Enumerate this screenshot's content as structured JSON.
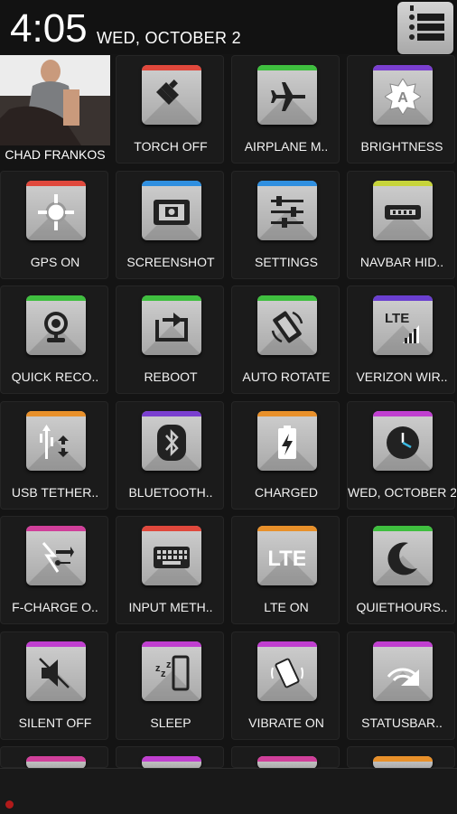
{
  "status": {
    "time": "4:05",
    "date": "WED, OCTOBER 2"
  },
  "profile": {
    "name": "CHAD FRANKOS"
  },
  "tiles": [
    {
      "label": "TORCH OFF",
      "icon": "torch-icon",
      "accent": "#e0483c"
    },
    {
      "label": "AIRPLANE M..",
      "icon": "airplane-icon",
      "accent": "#3fbf3f"
    },
    {
      "label": "BRIGHTNESS",
      "icon": "brightness-icon",
      "accent": "#7a3fd0"
    },
    {
      "label": "GPS ON",
      "icon": "gps-icon",
      "accent": "#e0483c"
    },
    {
      "label": "SCREENSHOT",
      "icon": "screenshot-icon",
      "accent": "#2f8fe0"
    },
    {
      "label": "SETTINGS",
      "icon": "settings-icon",
      "accent": "#2f8fe0"
    },
    {
      "label": "NAVBAR HID..",
      "icon": "navbar-icon",
      "accent": "#c7d43a"
    },
    {
      "label": "QUICK RECO..",
      "icon": "quick-record-icon",
      "accent": "#3fbf3f"
    },
    {
      "label": "REBOOT",
      "icon": "reboot-icon",
      "accent": "#3fbf3f"
    },
    {
      "label": "AUTO ROTATE",
      "icon": "auto-rotate-icon",
      "accent": "#3fbf3f"
    },
    {
      "label": "VERIZON WIR..",
      "icon": "lte-signal-icon",
      "accent": "#6a3fd0"
    },
    {
      "label": "USB TETHER..",
      "icon": "usb-tether-icon",
      "accent": "#e8902a"
    },
    {
      "label": "BLUETOOTH..",
      "icon": "bluetooth-icon",
      "accent": "#7a3fd0"
    },
    {
      "label": "CHARGED",
      "icon": "battery-charged-icon",
      "accent": "#e8902a"
    },
    {
      "label": "WED, OCTOBER 2",
      "icon": "clock-icon",
      "accent": "#c03fd0"
    },
    {
      "label": "F-CHARGE O..",
      "icon": "fast-charge-icon",
      "accent": "#d03f9a"
    },
    {
      "label": "INPUT METH..",
      "icon": "keyboard-icon",
      "accent": "#e0483c"
    },
    {
      "label": "LTE ON",
      "icon": "lte-icon",
      "accent": "#e8902a"
    },
    {
      "label": "QUIETHOURS..",
      "icon": "moon-icon",
      "accent": "#3fbf3f"
    },
    {
      "label": "SILENT OFF",
      "icon": "silent-off-icon",
      "accent": "#c03fd0"
    },
    {
      "label": "SLEEP",
      "icon": "sleep-icon",
      "accent": "#c03fd0"
    },
    {
      "label": "VIBRATE ON",
      "icon": "vibrate-icon",
      "accent": "#c03fd0"
    },
    {
      "label": "STATUSBAR..",
      "icon": "statusbar-icon",
      "accent": "#c03fd0"
    }
  ],
  "partial_row_accents": [
    "#d03f9a",
    "#c03fd0",
    "#d03f9a",
    "#e8902a"
  ]
}
